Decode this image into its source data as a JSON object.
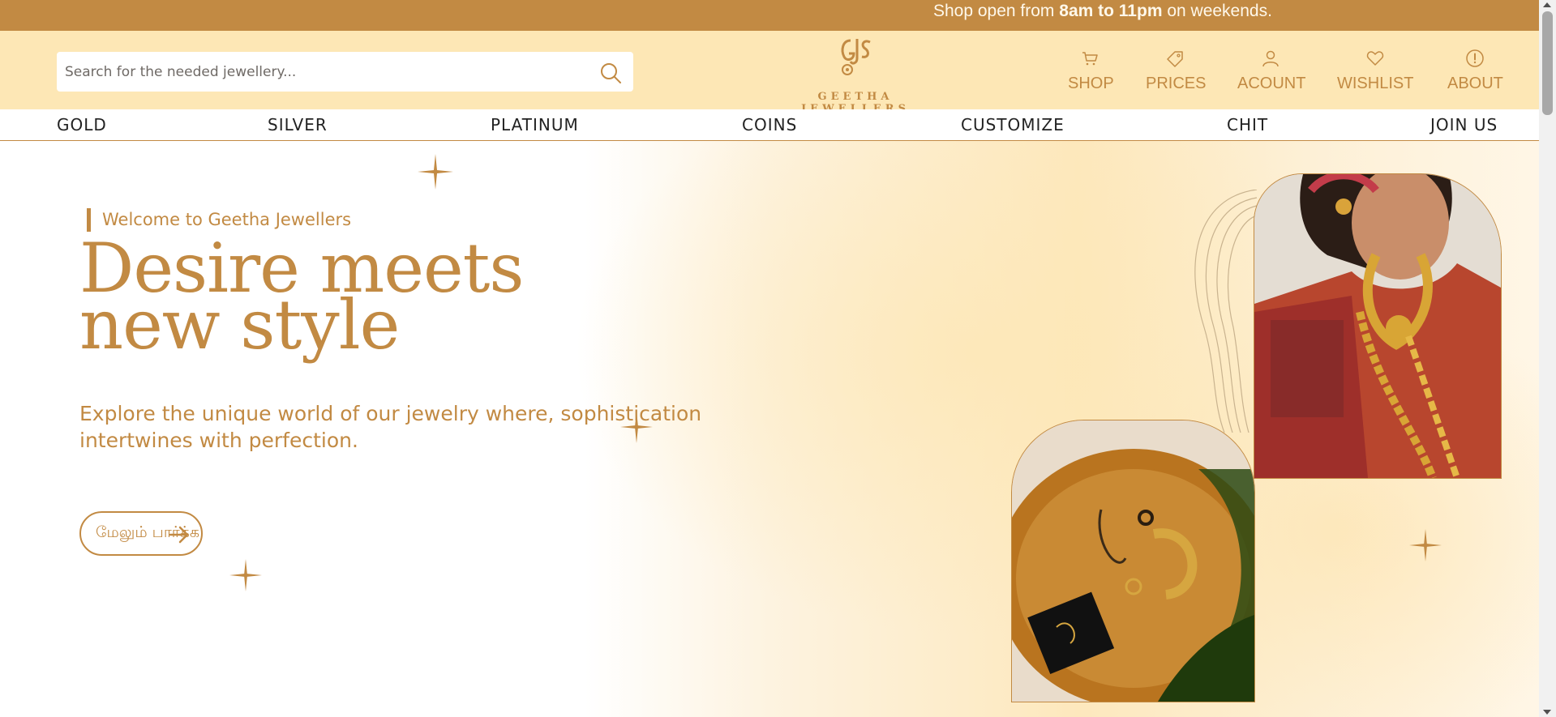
{
  "topbar": {
    "prefix": "Shop open from ",
    "hours": "8am to 11pm",
    "suffix": " on weekends."
  },
  "header": {
    "search_placeholder": "Search for the needed jewellery...",
    "brand_name": "GEETHA JEWELLERS",
    "nav": [
      {
        "label": "SHOP",
        "icon": "cart-icon"
      },
      {
        "label": "PRICES",
        "icon": "tag-icon"
      },
      {
        "label": "ACOUNT",
        "icon": "user-icon"
      },
      {
        "label": "WISHLIST",
        "icon": "heart-icon"
      },
      {
        "label": "ABOUT",
        "icon": "info-icon"
      }
    ]
  },
  "categories": [
    "GOLD",
    "SILVER",
    "PLATINUM",
    "COINS",
    "CUSTOMIZE",
    "CHIT",
    "JOIN US"
  ],
  "hero": {
    "welcome": "Welcome to Geetha Jewellers",
    "headline_line1": "Desire meets",
    "headline_line2": "new style",
    "subtext_line1": "Explore the unique world of our jewelry where, sophistication",
    "subtext_line2": "intertwines with perfection.",
    "cta_label": "மேலும் பார்க்க"
  },
  "colors": {
    "brand": "#c28a43",
    "header_bg": "#fde7b5",
    "topbar_bg": "#c28a43"
  }
}
